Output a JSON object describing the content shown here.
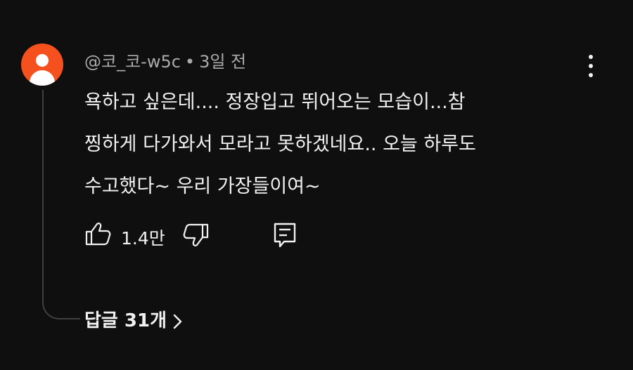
{
  "comment": {
    "author": "@코_코-w5c",
    "separator": "•",
    "time": "3일 전",
    "text_lines": [
      "욕하고 싶은데.... 정장입고 뛰어오는 모습이...참",
      "찡하게 다가와서 모라고 못하겠네요.. 오늘 하루도",
      "수고했다~ 우리 가장들이여~"
    ],
    "likes": "1.4만",
    "replies_label": "답글 31개"
  },
  "colors": {
    "background": "#0f0f0f",
    "avatar": "#f4511e",
    "primary_text": "#f1f1f1",
    "secondary_text": "#aaaaaa",
    "thread_line": "#3f3f3f"
  },
  "icons": {
    "avatar": "person-avatar-icon",
    "more": "more-vertical-icon",
    "like": "thumbs-up-icon",
    "dislike": "thumbs-down-icon",
    "reply": "reply-comment-icon",
    "expand": "chevron-right-icon"
  }
}
